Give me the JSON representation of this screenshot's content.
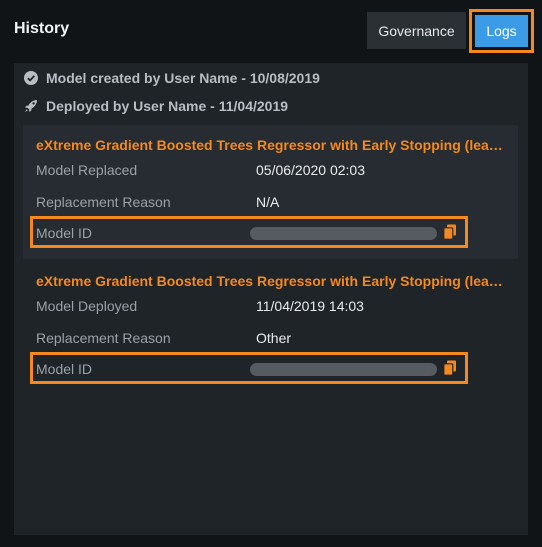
{
  "header": {
    "title": "History",
    "governance_label": "Governance",
    "logs_label": "Logs"
  },
  "events": [
    {
      "icon": "check-circle-icon",
      "text": "Model created by User Name - 10/08/2019"
    },
    {
      "icon": "rocket-icon",
      "text": "Deployed by User Name - 11/04/2019"
    }
  ],
  "cards": [
    {
      "title": "eXtreme Gradient Boosted Trees Regressor with Early Stopping (learning...",
      "rows": [
        {
          "label": "Model Replaced",
          "value": "05/06/2020 02:03"
        },
        {
          "label": "Replacement Reason",
          "value": "N/A"
        },
        {
          "label": "Model ID",
          "value": ""
        }
      ]
    },
    {
      "title": "eXtreme Gradient Boosted Trees Regressor with Early Stopping (learning...",
      "rows": [
        {
          "label": "Model Deployed",
          "value": "11/04/2019 14:03"
        },
        {
          "label": "Replacement Reason",
          "value": "Other"
        },
        {
          "label": "Model ID",
          "value": ""
        }
      ]
    }
  ],
  "colors": {
    "accent": "#f5891f",
    "primary_button": "#3c9be6",
    "panel": "#1f2428",
    "background": "#101417"
  }
}
